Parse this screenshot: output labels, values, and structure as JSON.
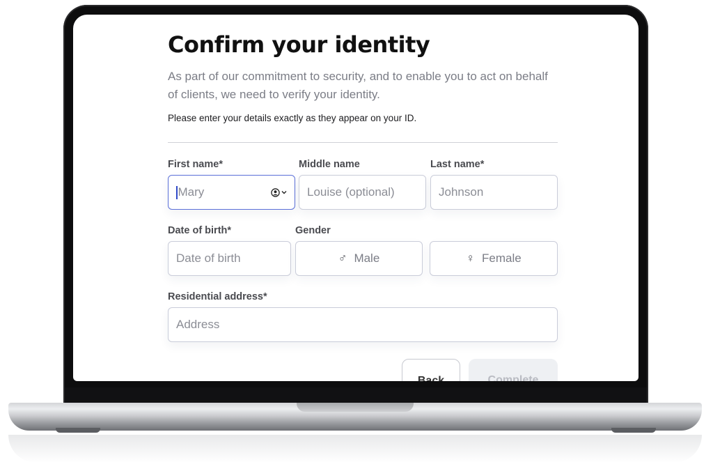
{
  "form": {
    "title": "Confirm your identity",
    "subtitle": "As part of our commitment to security, and to enable you to act on behalf of clients, we need to verify your identity.",
    "note": "Please enter your details exactly as they appear on your ID.",
    "first_name": {
      "label": "First name*",
      "placeholder": "Mary"
    },
    "middle_name": {
      "label": "Middle name",
      "placeholder": "Louise (optional)"
    },
    "last_name": {
      "label": "Last name*",
      "placeholder": "Johnson"
    },
    "dob": {
      "label": "Date of birth*",
      "placeholder": "Date of birth"
    },
    "gender": {
      "label": "Gender",
      "options": [
        {
          "label": "Male",
          "symbol": "♂"
        },
        {
          "label": "Female",
          "symbol": "♀"
        }
      ]
    },
    "address": {
      "label": "Residential address*",
      "placeholder": "Address"
    },
    "back_label": "Back",
    "complete_label": "Complete"
  },
  "colors": {
    "focus_border": "#5a6fd8",
    "field_border": "#c9ccd9",
    "title": "#111111",
    "subtitle": "#7b7d86"
  }
}
